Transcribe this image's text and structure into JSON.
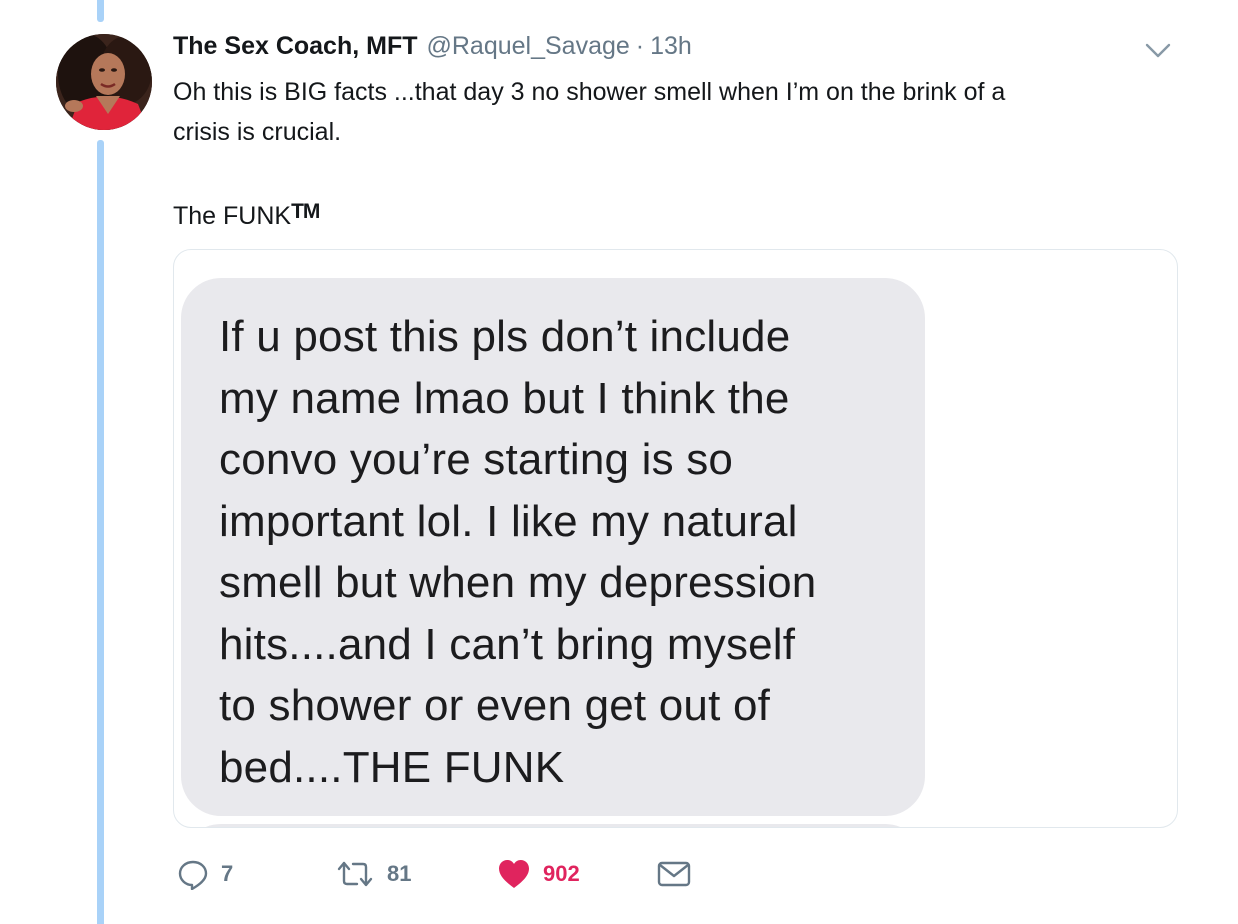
{
  "tweet": {
    "author": {
      "display_name": "The Sex Coach, MFT",
      "handle": "@Raquel_Savage",
      "separator": "·",
      "time": "13h",
      "avatar_icon": "profile-photo"
    },
    "text_line1": "Oh this is BIG facts ...that day 3 no shower smell when I’m on the brink of a",
    "text_line2": "crisis is crucial.",
    "text_line3": "The FUNK",
    "trademark": "TM",
    "menu_icon": "chevron-down-icon"
  },
  "media": {
    "message_lines": [
      "If u post this pls don’t include",
      "my name lmao but I think the",
      "convo you’re starting is so",
      "important lol. I like my natural",
      "smell but when my depression",
      "hits....and I can’t bring myself",
      "to shower or even get out of",
      "bed....THE FUNK"
    ]
  },
  "actions": {
    "replies": "7",
    "retweets": "81",
    "likes": "902",
    "reply_icon": "reply-icon",
    "retweet_icon": "retweet-icon",
    "like_icon": "heart-icon",
    "dm_icon": "envelope-icon"
  },
  "colors": {
    "thread_line": "#a9d2f8",
    "secondary_text": "#657786",
    "like_color": "#e0245e",
    "bubble_bg": "#e9e9ed",
    "card_border": "#e1e8ed"
  }
}
